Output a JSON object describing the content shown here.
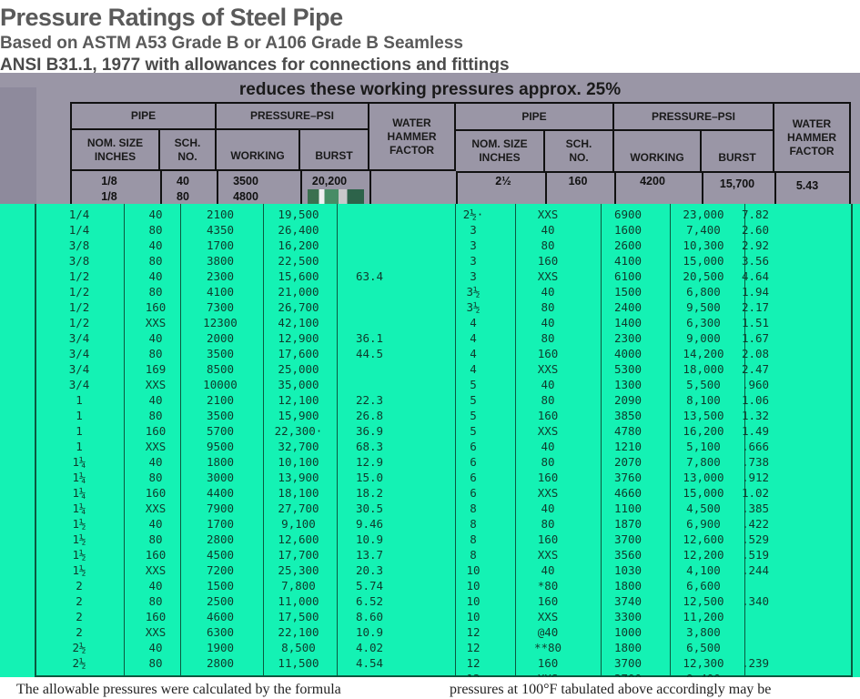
{
  "title": "Pressure Ratings of Steel Pipe",
  "subtitle1": "Based on ASTM A53 Grade B or A106 Grade B Seamless",
  "subtitle2": "ANSI B31.1, 1977 with allowances for connections and fittings",
  "subtitle3": "reduces these working pressures approx. 25%",
  "headers": {
    "pipe": "PIPE",
    "pressure": "PRESSURE–PSI",
    "water_hammer": "WATER HAMMER FACTOR",
    "nom_size": "NOM. SIZE INCHES",
    "sch": "SCH. NO.",
    "working": "WORKING",
    "burst": "BURST"
  },
  "top_rows": [
    {
      "size": "1/8",
      "sch": "40",
      "working": "3500",
      "burst": "20,200",
      "whf": "",
      "size2": "2½",
      "sch2": "160",
      "working2": "4200",
      "burst2": "15,700",
      "whf2": "5.43"
    },
    {
      "size": "1/8",
      "sch": "80",
      "working": "4800",
      "burst": "",
      "whf": "",
      "size2": "",
      "sch2": "",
      "working2": "",
      "burst2": "",
      "whf2": ""
    }
  ],
  "rows": [
    {
      "size": "1/4",
      "sch": "40",
      "working": "2100",
      "burst": "19,500",
      "whf": "",
      "size2": "2½·",
      "sch2": "XXS",
      "working2": "6900",
      "burst2": "23,000",
      "whf2": "7.82"
    },
    {
      "size": "1/4",
      "sch": "80",
      "working": "4350",
      "burst": "26,400",
      "whf": "",
      "size2": "3",
      "sch2": "40",
      "working2": "1600",
      "burst2": "7,400",
      "whf2": "2.60"
    },
    {
      "size": "3/8",
      "sch": "40",
      "working": "1700",
      "burst": "16,200",
      "whf": "",
      "size2": "3",
      "sch2": "80",
      "working2": "2600",
      "burst2": "10,300",
      "whf2": "2.92"
    },
    {
      "size": "3/8",
      "sch": "80",
      "working": "3800",
      "burst": "22,500",
      "whf": "",
      "size2": "3",
      "sch2": "160",
      "working2": "4100",
      "burst2": "15,000",
      "whf2": "3.56"
    },
    {
      "size": "1/2",
      "sch": "40",
      "working": "2300",
      "burst": "15,600",
      "whf": "63.4",
      "size2": "3",
      "sch2": "XXS",
      "working2": "6100",
      "burst2": "20,500",
      "whf2": "4.64"
    },
    {
      "size": "1/2",
      "sch": "80",
      "working": "4100",
      "burst": "21,000",
      "whf": "",
      "size2": "3½",
      "sch2": "40",
      "working2": "1500",
      "burst2": "6,800",
      "whf2": "1.94"
    },
    {
      "size": "1/2",
      "sch": "160",
      "working": "7300",
      "burst": "26,700",
      "whf": "",
      "size2": "3½",
      "sch2": "80",
      "working2": "2400",
      "burst2": "9,500",
      "whf2": "2.17"
    },
    {
      "size": "1/2",
      "sch": "XXS",
      "working": "12300",
      "burst": "42,100",
      "whf": "",
      "size2": "4",
      "sch2": "40",
      "working2": "1400",
      "burst2": "6,300",
      "whf2": "1.51"
    },
    {
      "size": "3/4",
      "sch": "40",
      "working": "2000",
      "burst": "12,900",
      "whf": "36.1",
      "size2": "4",
      "sch2": "80",
      "working2": "2300",
      "burst2": "9,000",
      "whf2": "1.67"
    },
    {
      "size": "3/4",
      "sch": "80",
      "working": "3500",
      "burst": "17,600",
      "whf": "44.5",
      "size2": "4",
      "sch2": "160",
      "working2": "4000",
      "burst2": "14,200",
      "whf2": "2.08"
    },
    {
      "size": "3/4",
      "sch": "169",
      "working": "8500",
      "burst": "25,000",
      "whf": "",
      "size2": "4",
      "sch2": "XXS",
      "working2": "5300",
      "burst2": "18,000",
      "whf2": "2.47"
    },
    {
      "size": "3/4",
      "sch": "XXS",
      "working": "10000",
      "burst": "35,000",
      "whf": "",
      "size2": "5",
      "sch2": "40",
      "working2": "1300",
      "burst2": "5,500",
      "whf2": ".960"
    },
    {
      "size": "1",
      "sch": "40",
      "working": "2100",
      "burst": "12,100",
      "whf": "22.3",
      "size2": "5",
      "sch2": "80",
      "working2": "2090",
      "burst2": "8,100",
      "whf2": "1.06"
    },
    {
      "size": "1",
      "sch": "80",
      "working": "3500",
      "burst": "15,900",
      "whf": "26.8",
      "size2": "5",
      "sch2": "160",
      "working2": "3850",
      "burst2": "13,500",
      "whf2": "1.32"
    },
    {
      "size": "1",
      "sch": "160",
      "working": "5700",
      "burst": "22,300·",
      "whf": "36.9",
      "size2": "5",
      "sch2": "XXS",
      "working2": "4780",
      "burst2": "16,200",
      "whf2": "1.49"
    },
    {
      "size": "1",
      "sch": "XXS",
      "working": "9500",
      "burst": "32,700",
      "whf": "68.3",
      "size2": "6",
      "sch2": "40",
      "working2": "1210",
      "burst2": "5,100",
      "whf2": ".666"
    },
    {
      "size": "1¼",
      "sch": "40",
      "working": "1800",
      "burst": "10,100",
      "whf": "12.9",
      "size2": "6",
      "sch2": "80",
      "working2": "2070",
      "burst2": "7,800",
      "whf2": ".738"
    },
    {
      "size": "1¼",
      "sch": "80",
      "working": "3000",
      "burst": "13,900",
      "whf": "15.0",
      "size2": "6",
      "sch2": "160",
      "working2": "3760",
      "burst2": "13,000",
      "whf2": ".912"
    },
    {
      "size": "1¼",
      "sch": "160",
      "working": "4400",
      "burst": "18,100",
      "whf": "18.2",
      "size2": "6",
      "sch2": "XXS",
      "working2": "4660",
      "burst2": "15,000",
      "whf2": "1.02"
    },
    {
      "size": "1¼",
      "sch": "XXS",
      "working": "7900",
      "burst": "27,700",
      "whf": "30.5",
      "size2": "8",
      "sch2": "40",
      "working2": "1100",
      "burst2": "4,500",
      "whf2": ".385"
    },
    {
      "size": "1½",
      "sch": "40",
      "working": "1700",
      "burst": "9,100",
      "whf": "9.46",
      "size2": "8",
      "sch2": "80",
      "working2": "1870",
      "burst2": "6,900",
      "whf2": ".422"
    },
    {
      "size": "1½",
      "sch": "80",
      "working": "2800",
      "burst": "12,600",
      "whf": "10.9",
      "size2": "8",
      "sch2": "160",
      "working2": "3700",
      "burst2": "12,600",
      "whf2": ".529"
    },
    {
      "size": "1½",
      "sch": "160",
      "working": "4500",
      "burst": "17,700",
      "whf": "13.7",
      "size2": "8",
      "sch2": "XXS",
      "working2": "3560",
      "burst2": "12,200",
      "whf2": ".519"
    },
    {
      "size": "1½",
      "sch": "XXS",
      "working": "7200",
      "burst": "25,300",
      "whf": "20.3",
      "size2": "10",
      "sch2": "40",
      "working2": "1030",
      "burst2": "4,100",
      "whf2": ".244"
    },
    {
      "size": "2",
      "sch": "40",
      "working": "1500",
      "burst": "7,800",
      "whf": "5.74",
      "size2": "10",
      "sch2": "*80",
      "working2": "1800",
      "burst2": "6,600",
      "whf2": ""
    },
    {
      "size": "2",
      "sch": "80",
      "working": "2500",
      "burst": "11,000",
      "whf": "6.52",
      "size2": "10",
      "sch2": "160",
      "working2": "3740",
      "burst2": "12,500",
      "whf2": ".340"
    },
    {
      "size": "2",
      "sch": "160",
      "working": "4600",
      "burst": "17,500",
      "whf": "8.60",
      "size2": "10",
      "sch2": "XXS",
      "working2": "3300",
      "burst2": "11,200",
      "whf2": ""
    },
    {
      "size": "2",
      "sch": "XXS",
      "working": "6300",
      "burst": "22,100",
      "whf": "10.9",
      "size2": "12",
      "sch2": "@40",
      "working2": "1000",
      "burst2": "3,800",
      "whf2": ""
    },
    {
      "size": "2½",
      "sch": "40",
      "working": "1900",
      "burst": "8,500",
      "whf": "4.02",
      "size2": "12",
      "sch2": "**80",
      "working2": "1800",
      "burst2": "6,500",
      "whf2": ""
    },
    {
      "size": "2½",
      "sch": "80",
      "working": "2800",
      "burst": "11,500",
      "whf": "4.54",
      "size2": "12",
      "sch2": "160",
      "working2": "3700",
      "burst2": "12,300",
      "whf2": ".239"
    },
    {
      "size": "",
      "sch": "",
      "working": "",
      "burst": "",
      "whf": "",
      "size2": "12",
      "sch2": "XXS",
      "working2": "2700",
      "burst2": "9,400",
      "whf2": ""
    }
  ],
  "footer_left": "The allowable pressures were calculated by the formula",
  "footer_right": "pressures at 100°F tabulated above accordingly may be"
}
